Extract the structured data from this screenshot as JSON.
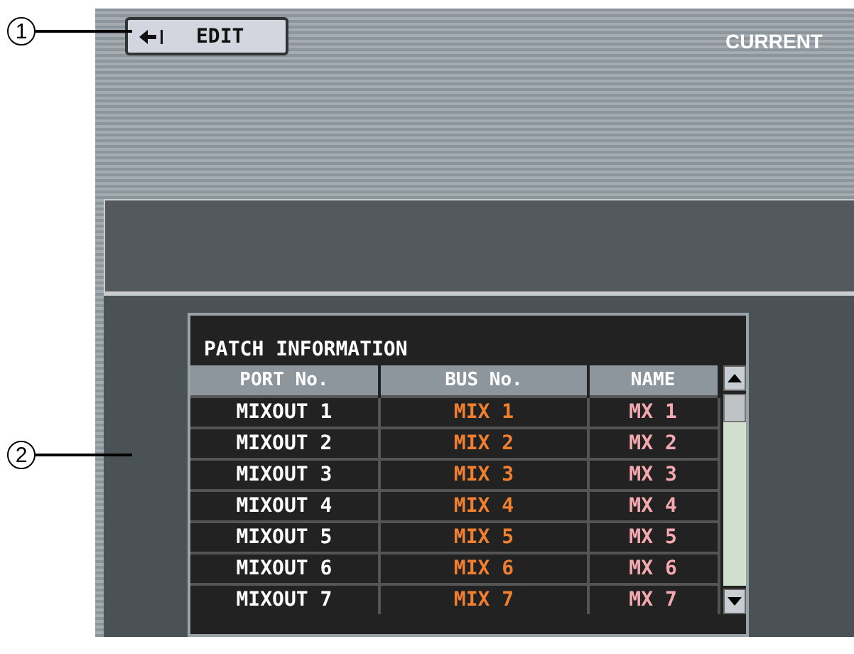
{
  "callouts": [
    "1",
    "2"
  ],
  "header": {
    "edit_button": "EDIT",
    "status": "CURRENT"
  },
  "patch_table": {
    "title": "PATCH INFORMATION",
    "columns": [
      "PORT No.",
      "BUS No.",
      "NAME"
    ],
    "rows": [
      [
        "MIXOUT 1",
        "MIX 1",
        "MX 1"
      ],
      [
        "MIXOUT 2",
        "MIX 2",
        "MX 2"
      ],
      [
        "MIXOUT 3",
        "MIX 3",
        "MX 3"
      ],
      [
        "MIXOUT 4",
        "MIX 4",
        "MX 4"
      ],
      [
        "MIXOUT 5",
        "MIX 5",
        "MX 5"
      ],
      [
        "MIXOUT 6",
        "MIX 6",
        "MX 6"
      ],
      [
        "MIXOUT 7",
        "MIX 7",
        "MX 7"
      ]
    ]
  }
}
